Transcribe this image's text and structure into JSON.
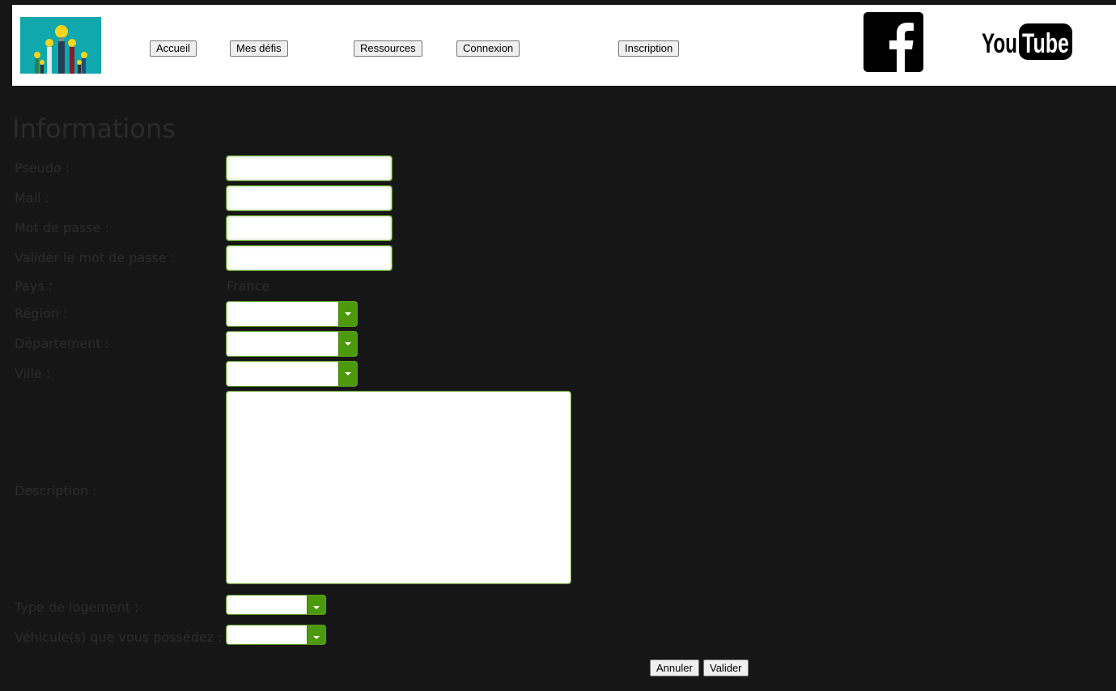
{
  "nav": {
    "accueil": "Accueil",
    "mes_defis": "Mes défis",
    "ressources": "Ressources",
    "connexion": "Connexion",
    "inscription": "Inscription"
  },
  "social": {
    "youtube_text_you": "You",
    "youtube_text_tube": "Tube"
  },
  "form": {
    "title": "Informations",
    "labels": {
      "pseudo": "Pseudo :",
      "mail": "Mail :",
      "password": "Mot de passe :",
      "password_confirm": "Valider le mot de passe :",
      "pays": "Pays :",
      "region": "Région :",
      "departement": "Département :",
      "ville": "Ville :",
      "description": "Description :",
      "logement": "Type de logement :",
      "vehicule": "Véhicule(s) que vous possédez :"
    },
    "pays_value": "France",
    "buttons": {
      "annuler": "Annuler",
      "valider": "Valider"
    }
  },
  "colors": {
    "background": "#161616",
    "accent_green": "#4c9a0c",
    "logo_bg": "#10a7ad"
  }
}
